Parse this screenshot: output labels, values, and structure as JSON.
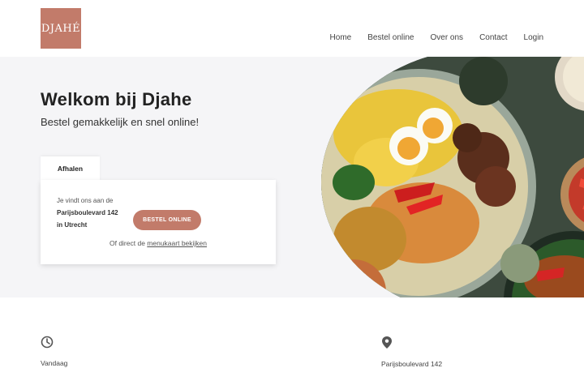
{
  "brand": {
    "logo_text": "DJAHÉ",
    "accent": "#c27b6a"
  },
  "nav": {
    "items": [
      "Home",
      "Bestel online",
      "Over ons",
      "Contact",
      "Login"
    ]
  },
  "hero": {
    "title": "Welkom bij Djahe",
    "subtitle": "Bestel gemakkelijk en snel online!"
  },
  "order_card": {
    "tab_label": "Afhalen",
    "line1": "Je vindt ons aan de",
    "street": "Parijsboulevard 142",
    "city": "in Utrecht",
    "button_label": "BESTEL ONLINE",
    "menu_prefix": "Of direct de",
    "menu_link": "menukaart bekijken"
  },
  "info": {
    "hours_icon": "clock-icon",
    "hours_label": "Vandaag",
    "location_icon": "location-pin-icon",
    "location_label": "Parijsboulevard 142"
  }
}
